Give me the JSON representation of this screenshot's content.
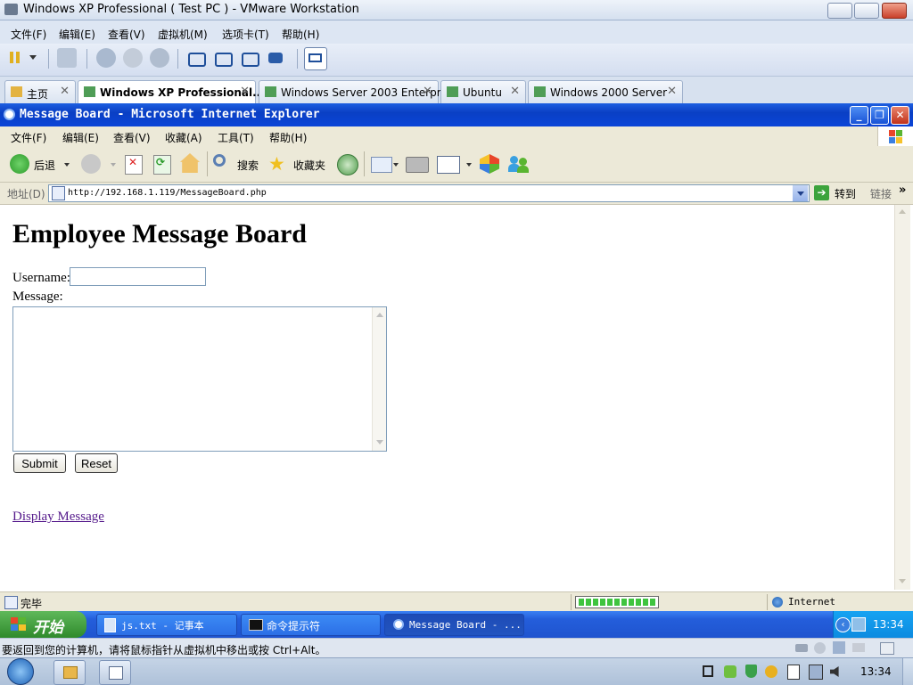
{
  "vmware": {
    "title": "Windows XP Professional ( Test PC ) - VMware Workstation",
    "menu": [
      "文件(F)",
      "编辑(E)",
      "查看(V)",
      "虚拟机(M)",
      "选项卡(T)",
      "帮助(H)"
    ],
    "tabs": [
      {
        "label": "主页"
      },
      {
        "label": "Windows XP Professional..."
      },
      {
        "label": "Windows Server 2003 Enterpr..."
      },
      {
        "label": "Ubuntu"
      },
      {
        "label": "Windows 2000 Server"
      }
    ],
    "status_text": "要返回到您的计算机，请将鼠标指针从虚拟机中移出或按 Ctrl+Alt。"
  },
  "ie": {
    "title": "Message Board - Microsoft Internet Explorer",
    "menu": [
      "文件(F)",
      "编辑(E)",
      "查看(V)",
      "收藏(A)",
      "工具(T)",
      "帮助(H)"
    ],
    "toolbar": {
      "back": "后退",
      "search": "搜索",
      "favorites": "收藏夹"
    },
    "address": {
      "label": "地址(D)",
      "url": "http://192.168.1.119/MessageBoard.php",
      "go": "转到",
      "links": "链接"
    },
    "status": {
      "text": "完毕",
      "zone": "Internet",
      "progress": 1.0
    }
  },
  "page": {
    "heading": "Employee Message Board",
    "username_label": "Username:",
    "username_value": "",
    "message_label": "Message:",
    "message_value": "",
    "submit": "Submit",
    "reset": "Reset",
    "display_link": "Display Message"
  },
  "xp_taskbar": {
    "start": "开始",
    "tasks": [
      "js.txt - 记事本",
      "命令提示符",
      "Message Board - ..."
    ],
    "clock": "13:34"
  },
  "win7_taskbar": {
    "clock": "13:34"
  }
}
